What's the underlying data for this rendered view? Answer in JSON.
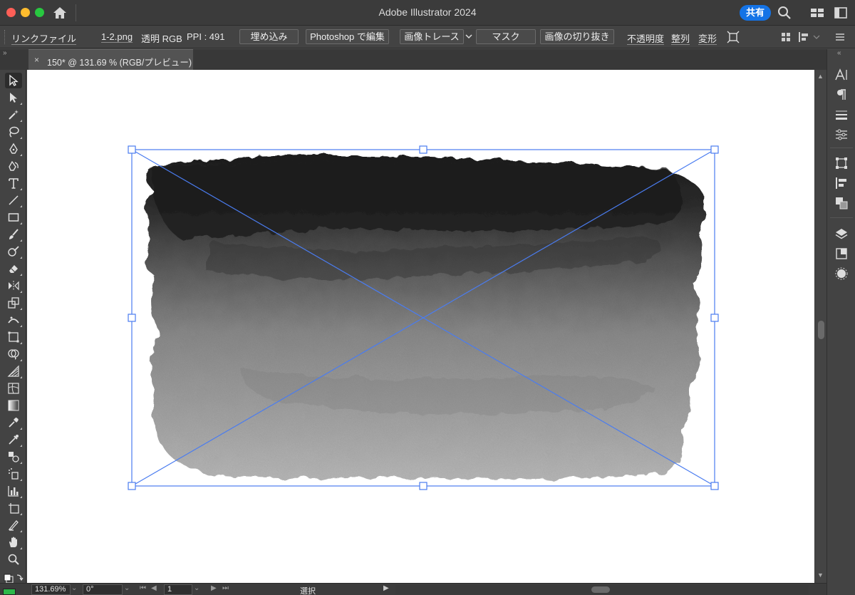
{
  "window": {
    "title": "Adobe Illustrator 2024",
    "share_label": "共有"
  },
  "control_bar": {
    "link_label": "リンクファイル",
    "file_name": "1-2.png",
    "color_info": "透明 RGB",
    "ppi_info": "PPI : 491",
    "embed_label": "埋め込み",
    "photoshop_label": "Photoshop で編集",
    "trace_label": "画像トレース",
    "mask_label": "マスク",
    "crop_label": "画像の切り抜き",
    "opacity_label": "不透明度",
    "align_label": "整列",
    "transform_label": "変形"
  },
  "document_tab": {
    "close_glyph": "×",
    "label": "150* @ 131.69 % (RGB/プレビュー)"
  },
  "tools": [
    {
      "name": "selection-tool-icon",
      "active": true
    },
    {
      "name": "direct-selection-tool-icon"
    },
    {
      "name": "magic-wand-tool-icon"
    },
    {
      "name": "lasso-tool-icon"
    },
    {
      "name": "pen-tool-icon"
    },
    {
      "name": "curvature-tool-icon"
    },
    {
      "name": "type-tool-icon"
    },
    {
      "name": "line-segment-tool-icon"
    },
    {
      "name": "rectangle-tool-icon"
    },
    {
      "name": "paintbrush-tool-icon"
    },
    {
      "name": "shaper-tool-icon"
    },
    {
      "name": "eraser-tool-icon"
    },
    {
      "name": "rotate-tool-icon"
    },
    {
      "name": "scale-tool-icon"
    },
    {
      "name": "width-tool-icon"
    },
    {
      "name": "free-transform-tool-icon"
    },
    {
      "name": "shape-builder-tool-icon"
    },
    {
      "name": "perspective-grid-tool-icon"
    },
    {
      "name": "mesh-tool-icon"
    },
    {
      "name": "gradient-tool-icon"
    },
    {
      "name": "eyedropper-tool-icon"
    },
    {
      "name": "measure-tool-icon"
    },
    {
      "name": "blend-tool-icon"
    },
    {
      "name": "symbol-sprayer-tool-icon"
    },
    {
      "name": "column-graph-tool-icon"
    },
    {
      "name": "artboard-tool-icon"
    },
    {
      "name": "slice-tool-icon"
    },
    {
      "name": "hand-tool-icon"
    },
    {
      "name": "zoom-tool-icon"
    }
  ],
  "status_bar": {
    "zoom": "131.69%",
    "rotation": "0°",
    "artboard": "1",
    "mode": "選択"
  },
  "colors": {
    "accent": "#1473e6",
    "selection": "#4a7cf0",
    "fill_swatch": "#2db84a"
  }
}
